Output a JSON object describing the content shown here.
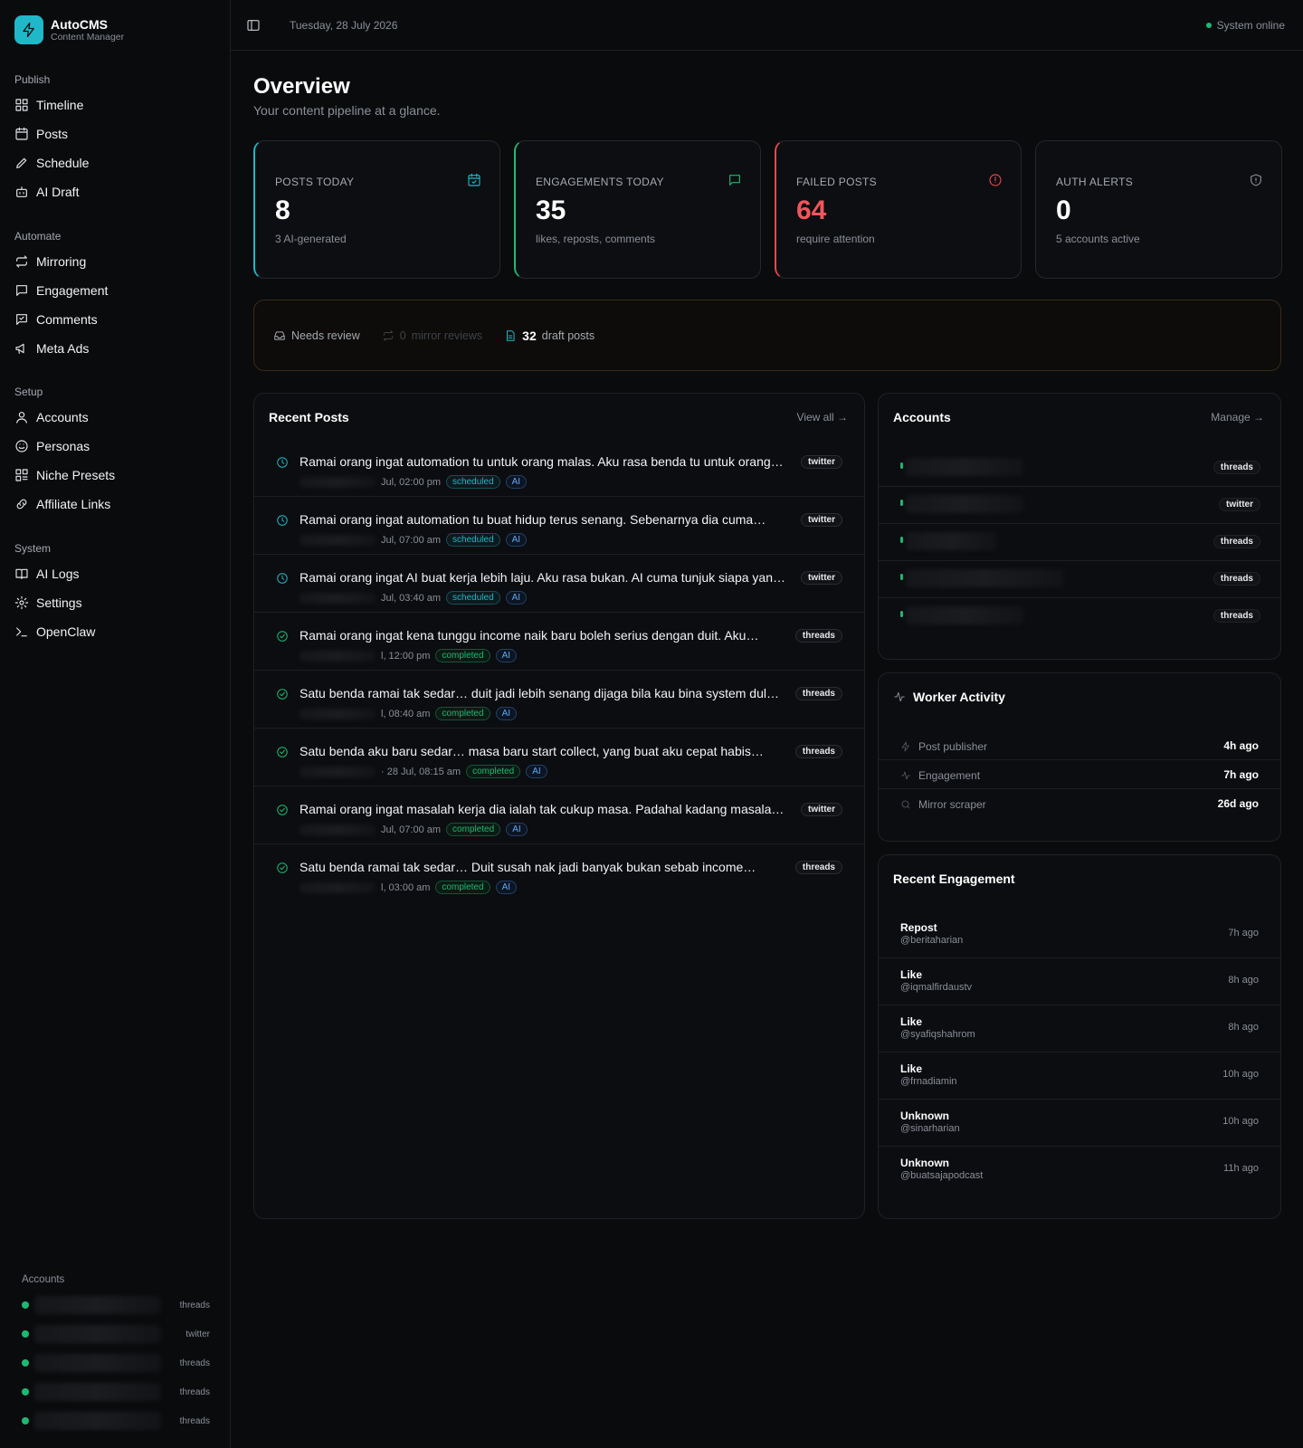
{
  "brand": {
    "name": "AutoCMS",
    "subtitle": "Content Manager"
  },
  "sidebar": {
    "groups": [
      {
        "title": "Publish",
        "items": [
          {
            "label": "Timeline",
            "icon": "timeline-icon"
          },
          {
            "label": "Posts",
            "icon": "calendar-icon"
          },
          {
            "label": "Schedule",
            "icon": "pencil-icon"
          },
          {
            "label": "AI Draft",
            "icon": "bot-icon"
          }
        ]
      },
      {
        "title": "Automate",
        "items": [
          {
            "label": "Mirroring",
            "icon": "repeat-icon"
          },
          {
            "label": "Engagement",
            "icon": "message-icon"
          },
          {
            "label": "Comments",
            "icon": "comment-icon"
          },
          {
            "label": "Meta Ads",
            "icon": "megaphone-icon"
          }
        ]
      },
      {
        "title": "Setup",
        "items": [
          {
            "label": "Accounts",
            "icon": "user-icon"
          },
          {
            "label": "Personas",
            "icon": "smile-icon"
          },
          {
            "label": "Niche Presets",
            "icon": "grid-icon"
          },
          {
            "label": "Affiliate Links",
            "icon": "link-icon"
          }
        ]
      },
      {
        "title": "System",
        "items": [
          {
            "label": "AI Logs",
            "icon": "book-icon"
          },
          {
            "label": "Settings",
            "icon": "gear-icon"
          },
          {
            "label": "OpenClaw",
            "icon": "terminal-icon"
          }
        ]
      }
    ],
    "accounts_title": "Accounts",
    "accounts": [
      {
        "platform": "threads"
      },
      {
        "platform": "twitter"
      },
      {
        "platform": "threads"
      },
      {
        "platform": "threads"
      },
      {
        "platform": "threads"
      }
    ]
  },
  "topbar": {
    "date": "Tuesday, 28 July 2026",
    "status": "System online"
  },
  "page": {
    "title": "Overview",
    "subtitle": "Your content pipeline at a glance."
  },
  "stats": [
    {
      "label": "POSTS TODAY",
      "value": "8",
      "desc": "3 AI-generated",
      "icon": "calendar-check-icon",
      "accent": "#1fb8c9"
    },
    {
      "label": "ENGAGEMENTS TODAY",
      "value": "35",
      "desc": "likes, reposts, comments",
      "icon": "message-icon",
      "accent": "#1db973"
    },
    {
      "label": "FAILED POSTS",
      "value": "64",
      "desc": "require attention",
      "icon": "alert-icon",
      "accent": "#e5484d"
    },
    {
      "label": "AUTH ALERTS",
      "value": "0",
      "desc": "5 accounts active",
      "icon": "shield-icon",
      "accent": "#24272c"
    }
  ],
  "review": {
    "needs_review": "Needs review",
    "mirror_count": "0",
    "mirror_label": "mirror reviews",
    "draft_count": "32",
    "draft_label": "draft posts"
  },
  "recent_posts": {
    "title": "Recent Posts",
    "link": "View all →",
    "items": [
      {
        "text": "Ramai orang ingat automation tu untuk orang malas. Aku rasa benda tu untuk orang…",
        "time": "Jul, 02:00 pm",
        "status": "scheduled",
        "ai": "AI",
        "platform": "twitter"
      },
      {
        "text": "Ramai orang ingat automation tu buat hidup terus senang. Sebenarnya dia cuma…",
        "time": "Jul, 07:00 am",
        "status": "scheduled",
        "ai": "AI",
        "platform": "twitter"
      },
      {
        "text": "Ramai orang ingat AI buat kerja lebih laju. Aku rasa bukan. AI cuma tunjuk siapa yan…",
        "time": "Jul, 03:40 am",
        "status": "scheduled",
        "ai": "AI",
        "platform": "twitter"
      },
      {
        "text": "Ramai orang ingat kena tunggu income naik baru boleh serius dengan duit. Aku…",
        "time": "l, 12:00 pm",
        "status": "completed",
        "ai": "AI",
        "platform": "threads"
      },
      {
        "text": "Satu benda ramai tak sedar… duit jadi lebih senang dijaga bila kau bina system dul…",
        "time": "l, 08:40 am",
        "status": "completed",
        "ai": "AI",
        "platform": "threads"
      },
      {
        "text": "Satu benda aku baru sedar… masa baru start collect, yang buat aku cepat habis…",
        "time": "· 28 Jul, 08:15 am",
        "status": "completed",
        "ai": "AI",
        "platform": "threads"
      },
      {
        "text": "Ramai orang ingat masalah kerja dia ialah tak cukup masa. Padahal kadang masalah…",
        "time": "Jul, 07:00 am",
        "status": "completed",
        "ai": "AI",
        "platform": "twitter"
      },
      {
        "text": "Satu benda ramai tak sedar… Duit susah nak jadi banyak bukan sebab income…",
        "time": "l, 03:00 am",
        "status": "completed",
        "ai": "AI",
        "platform": "threads"
      }
    ]
  },
  "accounts_card": {
    "title": "Accounts",
    "link": "Manage →",
    "items": [
      {
        "platform": "threads"
      },
      {
        "platform": "twitter"
      },
      {
        "platform": "threads"
      },
      {
        "platform": "threads"
      },
      {
        "platform": "threads"
      }
    ]
  },
  "worker": {
    "title": "Worker Activity",
    "items": [
      {
        "label": "Post publisher",
        "value": "4h ago"
      },
      {
        "label": "Engagement",
        "value": "7h ago"
      },
      {
        "label": "Mirror scraper",
        "value": "26d ago"
      }
    ]
  },
  "engagement": {
    "title": "Recent Engagement",
    "items": [
      {
        "type": "Repost",
        "handle": "@beritaharian",
        "when": "7h ago"
      },
      {
        "type": "Like",
        "handle": "@iqmalfirdaustv",
        "when": "8h ago"
      },
      {
        "type": "Like",
        "handle": "@syafiqshahrom",
        "when": "8h ago"
      },
      {
        "type": "Like",
        "handle": "@frnadiamin",
        "when": "10h ago"
      },
      {
        "type": "Unknown",
        "handle": "@sinarharian",
        "when": "10h ago"
      },
      {
        "type": "Unknown",
        "handle": "@buatsajapodcast",
        "when": "11h ago"
      }
    ]
  },
  "colors": {
    "accent": "#1fb8c9",
    "success": "#1db973",
    "danger": "#e5484d",
    "warning_border": "#3a2a18"
  }
}
